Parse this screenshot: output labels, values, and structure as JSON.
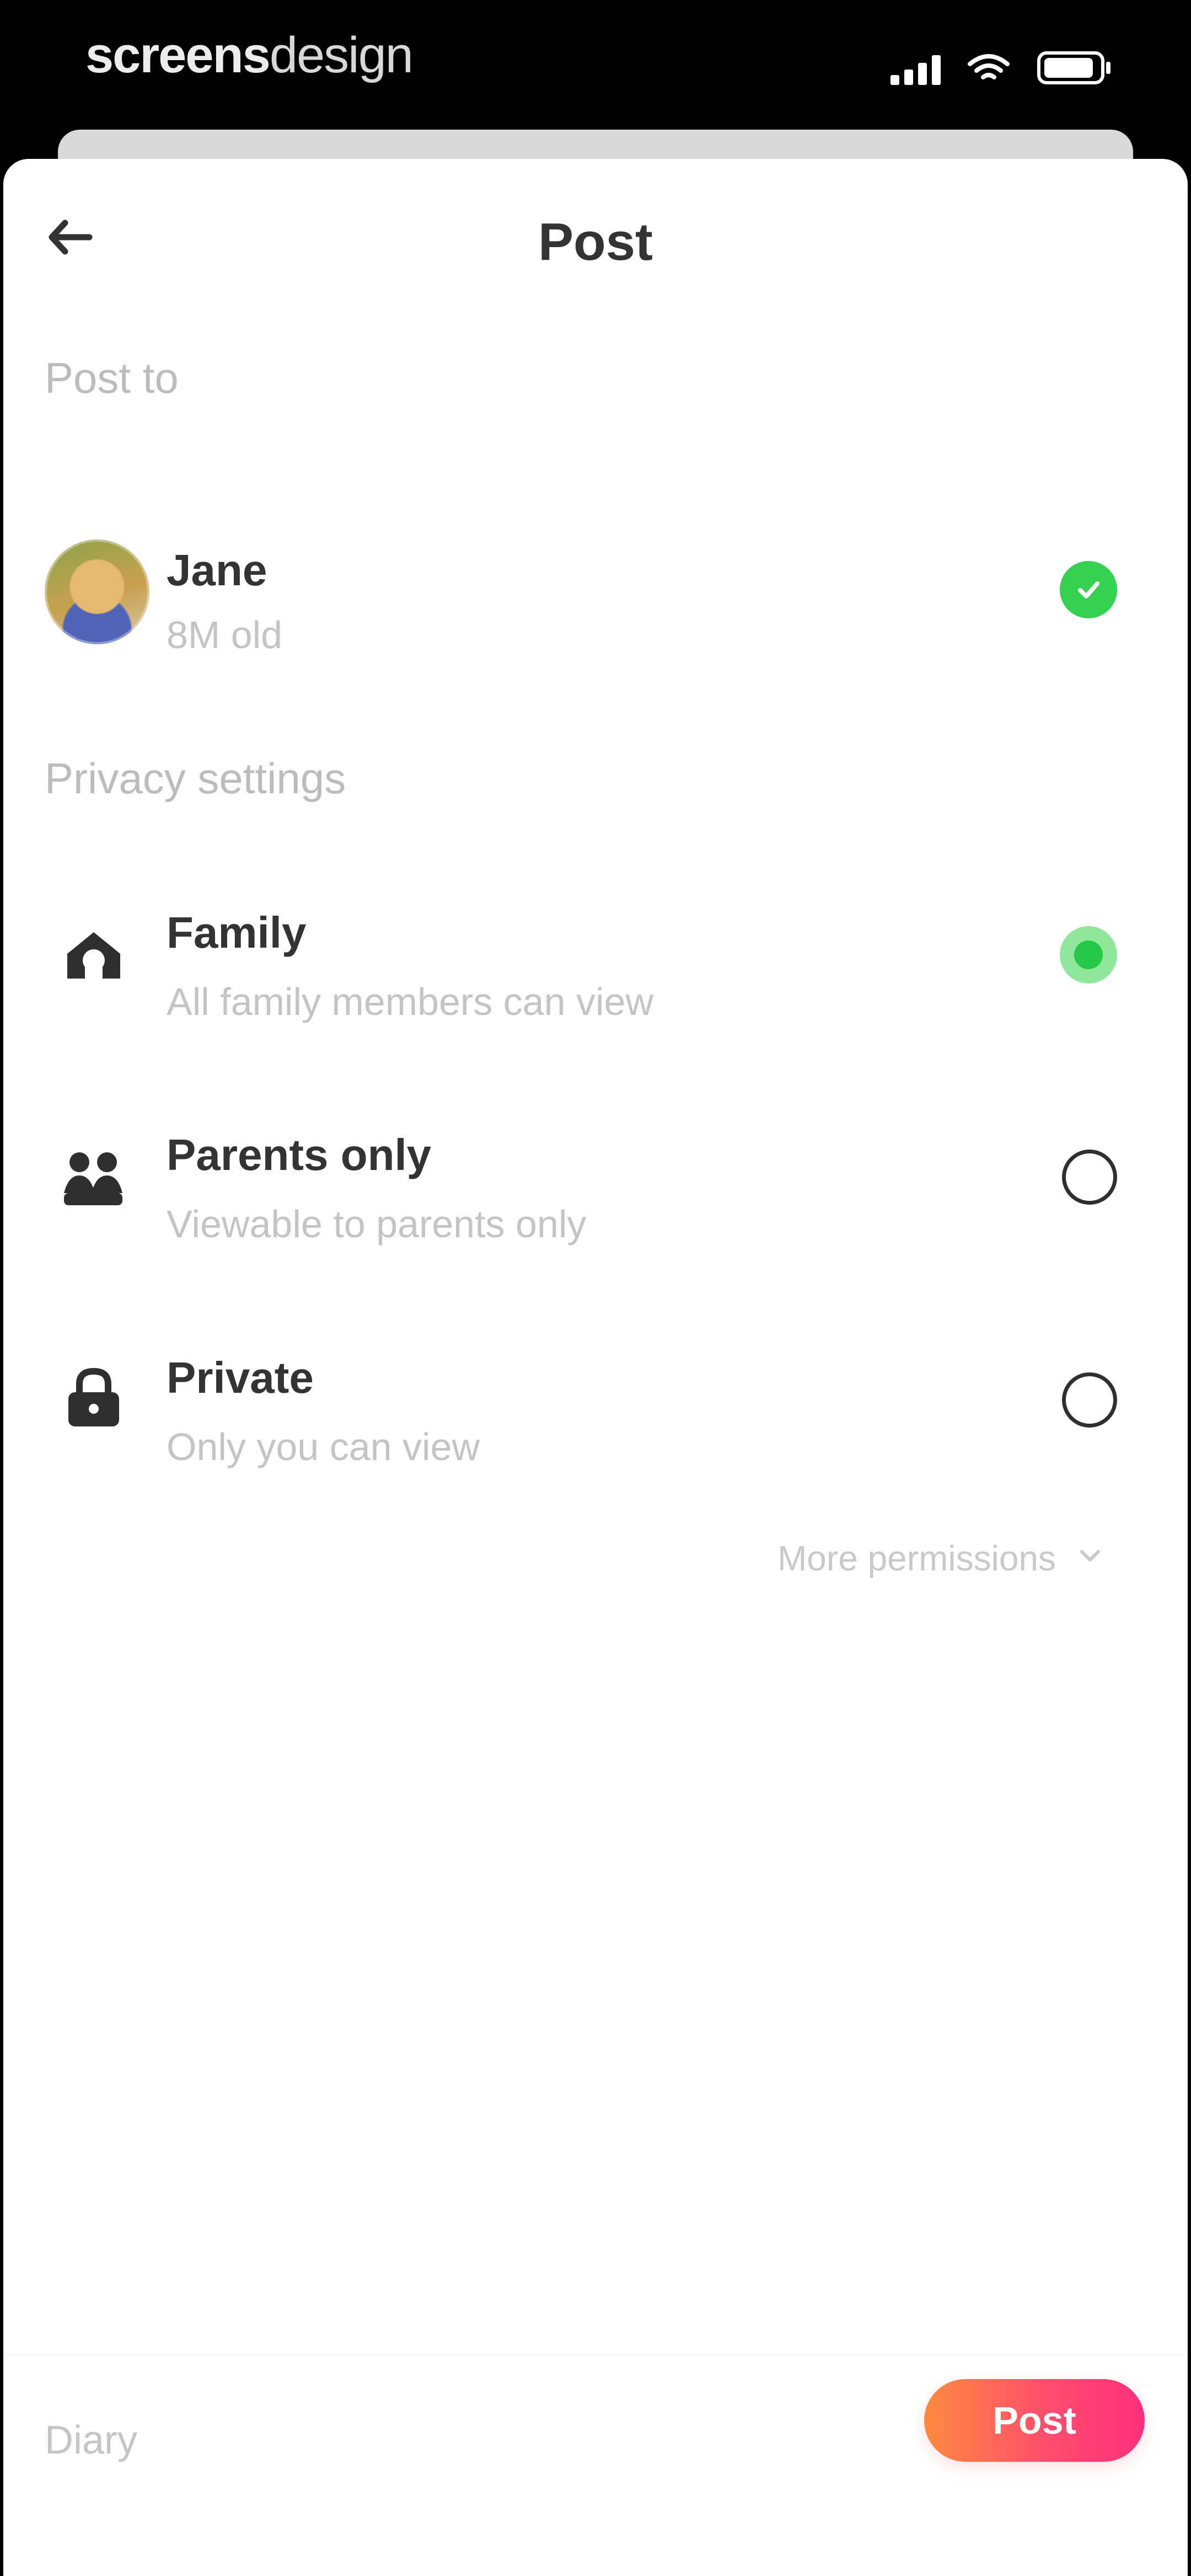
{
  "status_bar": {
    "brand_bold": "screens",
    "brand_light": "design"
  },
  "header": {
    "title": "Post"
  },
  "post_to": {
    "section_label": "Post to",
    "recipient_name": "Jane",
    "recipient_age": "8M old"
  },
  "privacy": {
    "section_label": "Privacy settings",
    "options": [
      {
        "title": "Family",
        "subtitle": "All family members can view",
        "selected": true,
        "icon": "home-icon"
      },
      {
        "title": "Parents only",
        "subtitle": "Viewable to parents only",
        "selected": false,
        "icon": "parents-icon"
      },
      {
        "title": "Private",
        "subtitle": "Only you can view",
        "selected": false,
        "icon": "lock-icon"
      }
    ],
    "more_permissions": "More permissions"
  },
  "footer": {
    "diary_label": "Diary",
    "post_button_label": "Post"
  },
  "colors": {
    "accent_green": "#33d24e",
    "post_gradient_start": "#ff8a3d",
    "post_gradient_end": "#ff2f7c"
  }
}
